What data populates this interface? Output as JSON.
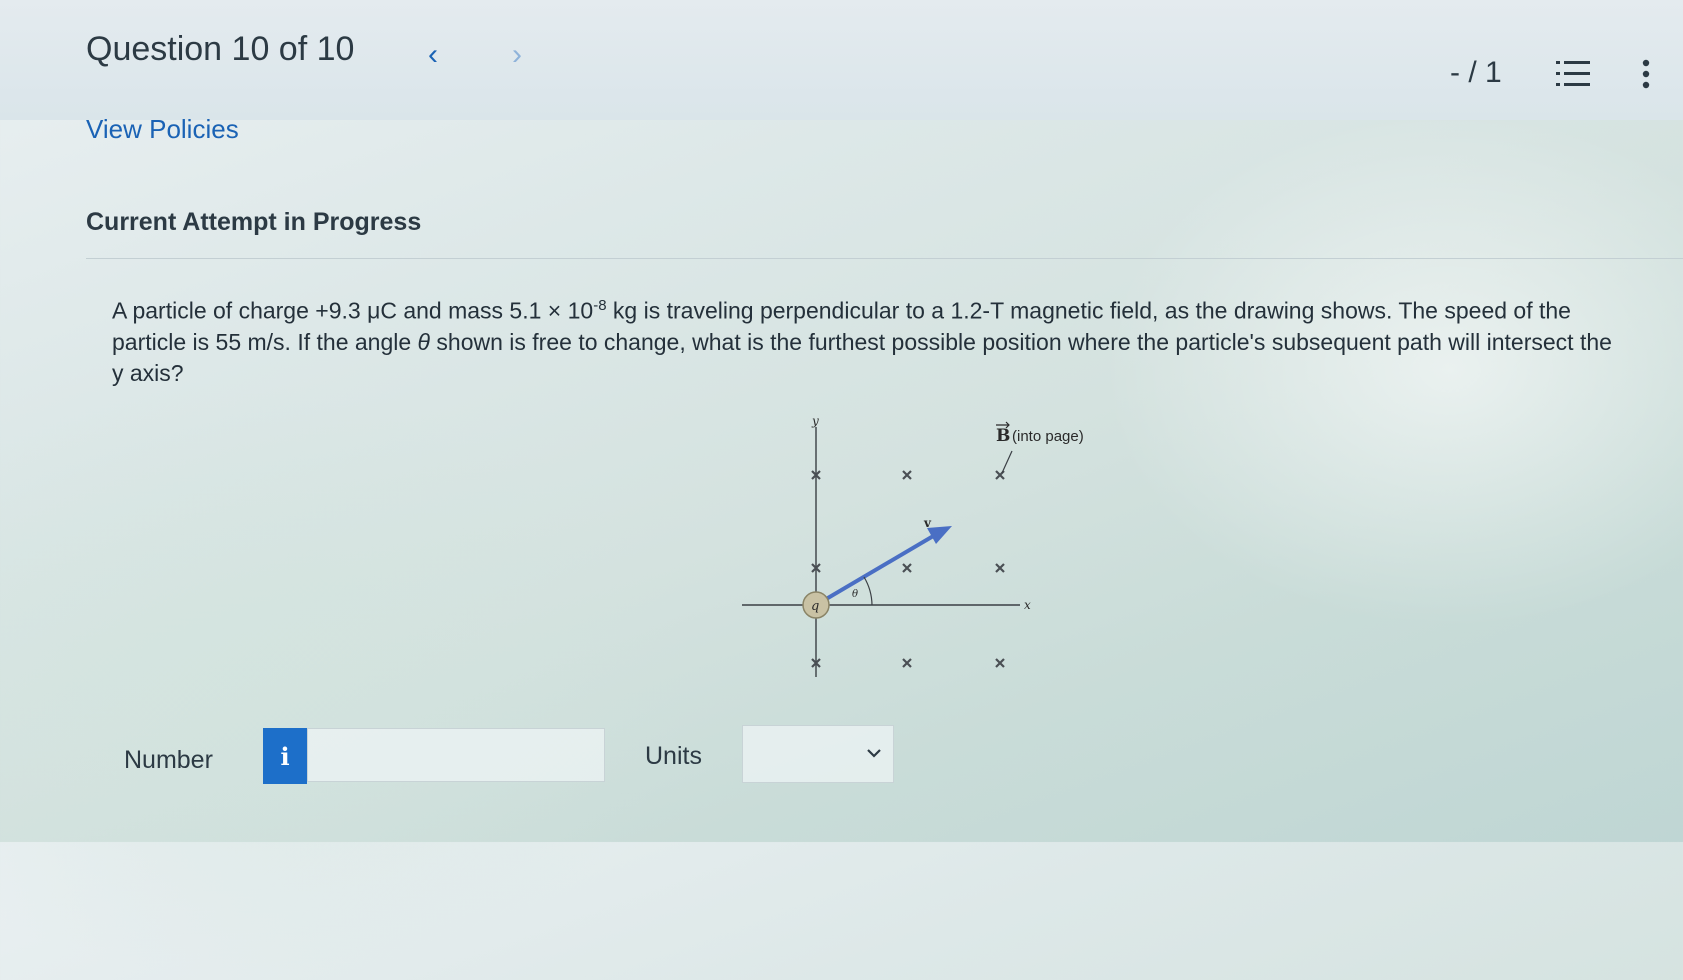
{
  "header": {
    "title": "Question 10 of 10",
    "prev_icon": "chevron-left-icon",
    "next_icon": "chevron-right-icon",
    "score": "- / 1",
    "list_icon": "question-list-icon",
    "more_icon": "more-vertical-icon"
  },
  "policies_link": "View Policies",
  "attempt_heading": "Current Attempt in Progress",
  "question": {
    "part1": "A particle of charge +9.3 μC and mass 5.1 × 10",
    "exponent": "-8",
    "part2": " kg is traveling perpendicular to a 1.2-T magnetic field, as the drawing shows. The speed of the particle is 55 m/s. If the angle ",
    "theta": "θ",
    "part3": " shown is free to change, what is the furthest possible position where the particle's subsequent path will intersect the y axis?"
  },
  "diagram": {
    "y_axis_label": "y",
    "x_axis_label": "x",
    "charge_label": "q",
    "angle_label": "θ",
    "velocity_label": "v",
    "field_vector": "B",
    "field_note": "(into page)"
  },
  "answer": {
    "number_label": "Number",
    "info_button": "i",
    "number_value": "",
    "units_label": "Units",
    "units_value": ""
  },
  "colors": {
    "link": "#1b63b5",
    "info_button": "#1d6fc9",
    "velocity_arrow": "#4a6fc4"
  }
}
